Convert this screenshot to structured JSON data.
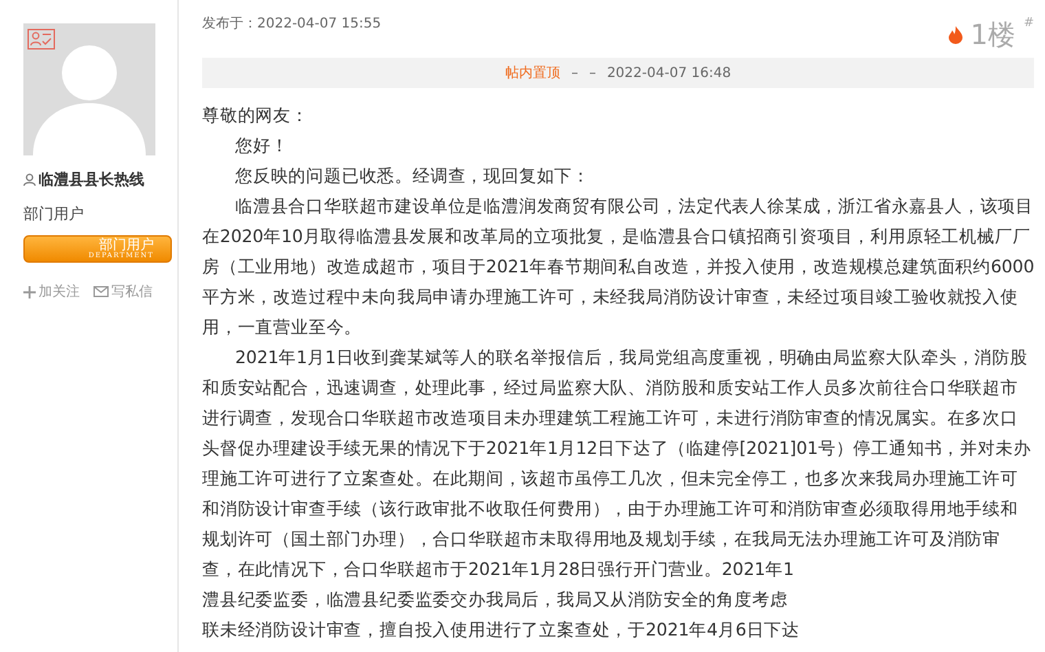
{
  "author": {
    "name": "临澧县县长热线",
    "group": "部门用户",
    "badge": {
      "label": "部门用户",
      "sublabel": "DEPARTMENT"
    },
    "actions": [
      {
        "label": "加关注",
        "kind": "follow"
      },
      {
        "label": "写私信",
        "kind": "message"
      }
    ]
  },
  "post": {
    "published": "发布于：2022-04-07 15:55",
    "floor": "1楼",
    "floor_mark": "#",
    "notice": {
      "label": "帖内置顶",
      "parts": [
        "–",
        "–",
        "2022-04-07 16:48"
      ]
    },
    "lines": [
      {
        "text": "尊敬的网友：",
        "indent": false
      },
      {
        "text": "您好！",
        "indent": true
      },
      {
        "text": "您反映的问题已收悉。经调查，现回复如下：",
        "indent": true
      },
      {
        "text": "临澧县合口华联超市建设单位是临澧润发商贸有限公司，法定代表人徐某成，浙江省永嘉县人，该项目",
        "indent": true
      },
      {
        "text": "在2020年10月取得临澧县发展和改革局的立项批复，是临澧县合口镇招商引资项目，利用原轻工机械厂厂",
        "indent": false
      },
      {
        "text": "房（工业用地）改造成超市，项目于2021年春节期间私自改造，并投入使用，改造规模总建筑面积约6000",
        "indent": false
      },
      {
        "text": "平方米，改造过程中未向我局申请办理施工许可，未经我局消防设计审查，未经过项目竣工验收就投入使",
        "indent": false
      },
      {
        "text": "用，一直营业至今。",
        "indent": false
      },
      {
        "text": "2021年1月1日收到龚某斌等人的联名举报信后，我局党组高度重视，明确由局监察大队牵头，消防股",
        "indent": true
      },
      {
        "text": "和质安站配合，迅速调查，处理此事，经过局监察大队、消防股和质安站工作人员多次前往合口华联超市",
        "indent": false
      },
      {
        "text": "进行调查，发现合口华联超市改造项目未办理建筑工程施工许可，未进行消防审查的情况属实。在多次口",
        "indent": false
      },
      {
        "text": "头督促办理建设手续无果的情况下于2021年1月12日下达了（临建停[2021]01号）停工通知书，并对未办",
        "indent": false
      },
      {
        "text": "理施工许可进行了立案查处。在此期间，该超市虽停工几次，但未完全停工，也多次来我局办理施工许可",
        "indent": false
      },
      {
        "text": "和消防设计审查手续（该行政审批不收取任何费用），由于办理施工许可和消防审查必须取得用地手续和",
        "indent": false
      },
      {
        "text": "规划许可（国土部门办理），合口华联超市未取得用地及规划手续，在我局无法办理施工许可及消防审",
        "indent": false
      },
      {
        "text": "查，在此情况下，合口华联超市于2021年1月28日强行开门营业。2021年1",
        "indent": false
      },
      {
        "text": "澧县纪委监委，临澧县纪委监委交办我局后，我局又从消防安全的角度考虑",
        "indent": false
      },
      {
        "text": "联未经消防设计审查，擅自投入使用进行了立案查处，于2021年4月6日下达",
        "indent": false
      }
    ]
  }
}
